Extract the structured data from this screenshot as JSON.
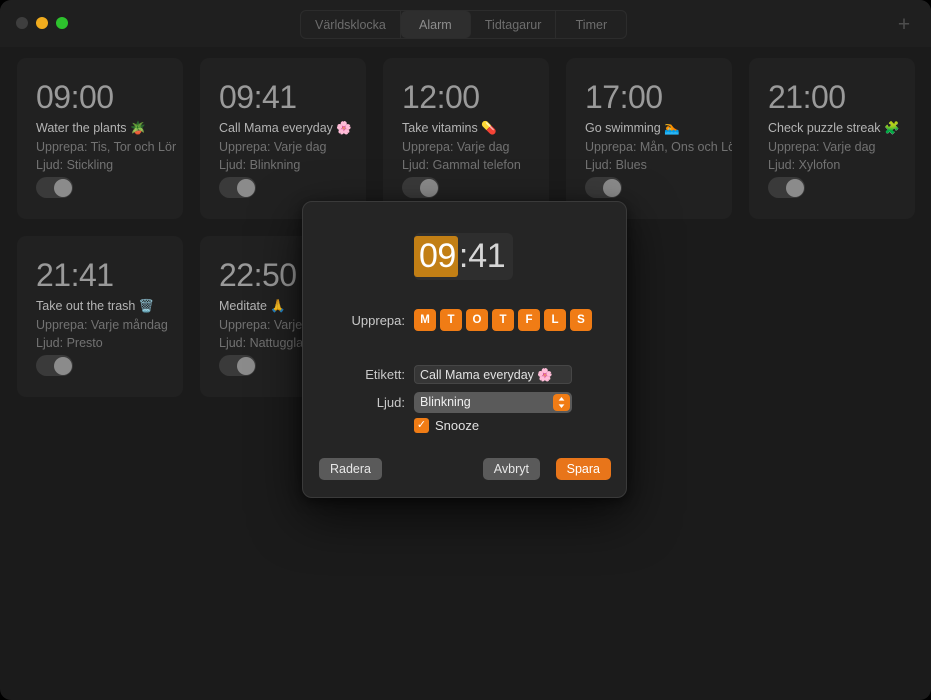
{
  "window": {
    "traffic_lights": [
      "close",
      "minimize",
      "maximize"
    ],
    "accent_color": "#f07c15",
    "background_color": "#1b1b1b",
    "card_color": "#212121"
  },
  "toolbar": {
    "tabs": [
      {
        "label": "Världsklocka",
        "selected": false
      },
      {
        "label": "Alarm",
        "selected": true
      },
      {
        "label": "Tidtagarur",
        "selected": false
      },
      {
        "label": "Timer",
        "selected": false
      }
    ],
    "add_button_label": "+"
  },
  "alarms": [
    {
      "time": "09:00",
      "label": "Water the plants 🪴",
      "repeat": "Upprepa: Tis, Tor och Lör",
      "sound": "Ljud: Stickling",
      "enabled": true
    },
    {
      "time": "09:41",
      "label": "Call Mama everyday 🌸",
      "repeat": "Upprepa: Varje dag",
      "sound": "Ljud: Blinkning",
      "enabled": true
    },
    {
      "time": "12:00",
      "label": "Take vitamins 💊",
      "repeat": "Upprepa: Varje dag",
      "sound": "Ljud: Gammal telefon",
      "enabled": true
    },
    {
      "time": "17:00",
      "label": "Go swimming 🏊",
      "repeat": "Upprepa: Mån, Ons och Lör",
      "sound": "Ljud: Blues",
      "enabled": true
    },
    {
      "time": "21:00",
      "label": "Check puzzle streak 🧩",
      "repeat": "Upprepa: Varje dag",
      "sound": "Ljud: Xylofon",
      "enabled": true
    },
    {
      "time": "21:41",
      "label": "Take out the trash 🗑️",
      "repeat": "Upprepa: Varje måndag",
      "sound": "Ljud: Presto",
      "enabled": true
    },
    {
      "time": "22:50",
      "label": "Meditate 🙏",
      "repeat": "Upprepa: Varje dag",
      "sound": "Ljud: Nattuggla",
      "enabled": true
    }
  ],
  "dialog": {
    "time": {
      "hour": "09",
      "separator": ":",
      "minute": "41",
      "selected_segment": "hour"
    },
    "repeat": {
      "label": "Upprepa:",
      "days": [
        {
          "letter": "M",
          "on": true
        },
        {
          "letter": "T",
          "on": true
        },
        {
          "letter": "O",
          "on": true
        },
        {
          "letter": "T",
          "on": true
        },
        {
          "letter": "F",
          "on": true
        },
        {
          "letter": "L",
          "on": true
        },
        {
          "letter": "S",
          "on": true
        }
      ]
    },
    "etikett": {
      "label": "Etikett:",
      "value": "Call Mama everyday 🌸",
      "placeholder": "Etikett"
    },
    "ljud": {
      "label": "Ljud:",
      "value": "Blinkning"
    },
    "snooze": {
      "label": "Snooze",
      "checked": true,
      "check_glyph": "✓"
    },
    "buttons": {
      "delete": "Radera",
      "cancel": "Avbryt",
      "save": "Spara"
    }
  }
}
